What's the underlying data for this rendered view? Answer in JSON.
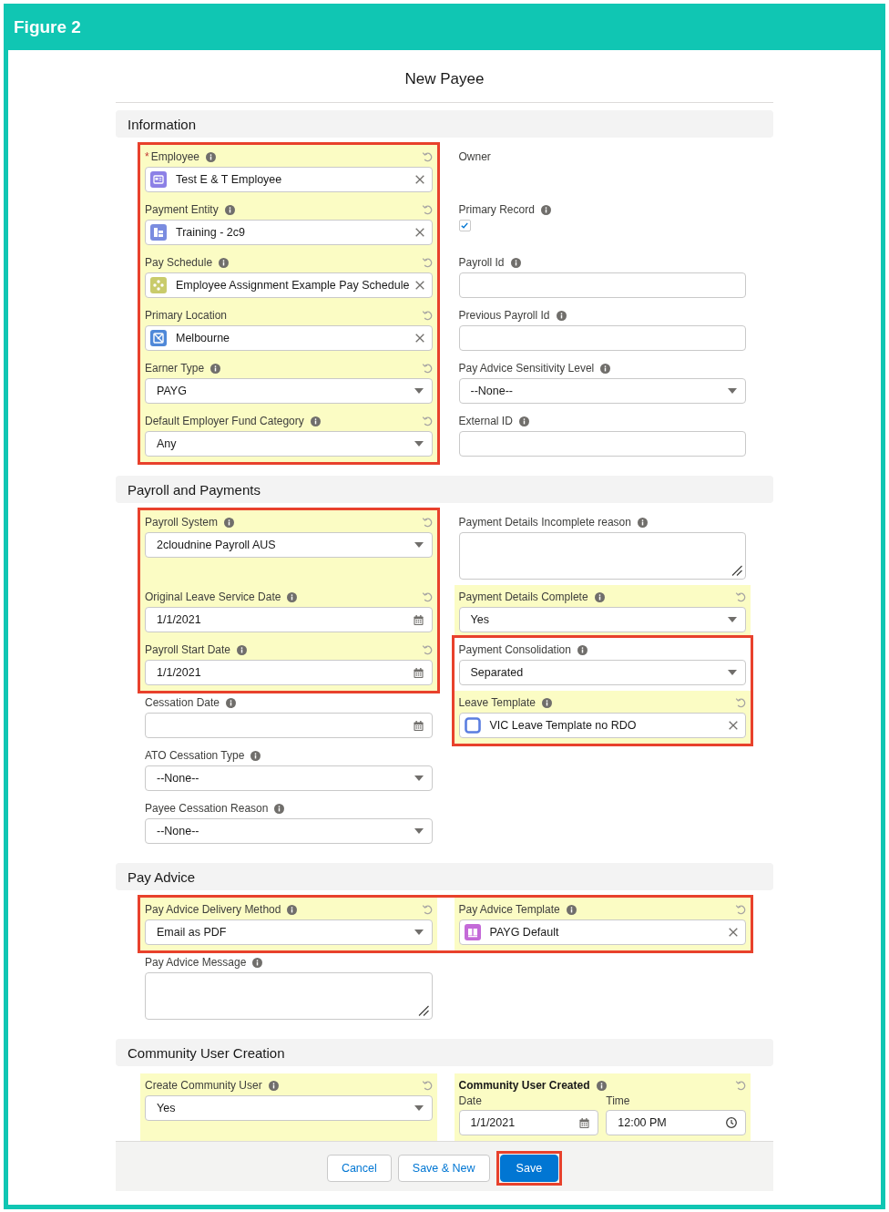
{
  "figure": {
    "title": "Figure 2"
  },
  "modal": {
    "title": "New Payee"
  },
  "sections": [
    {
      "title": "Information",
      "blocks": [
        {
          "kind": "columns",
          "left": [
            {
              "kind": "callout",
              "fields": [
                {
                  "kind": "lookup",
                  "label": "Employee",
                  "required_mark": "*",
                  "info": true,
                  "edited": true,
                  "value": "Test E & T Employee",
                  "color": "#8c80e6"
                },
                {
                  "kind": "lookup",
                  "label": "Payment Entity",
                  "info": true,
                  "edited": true,
                  "value": "Training - 2c9",
                  "color": "#7a8ce0"
                },
                {
                  "kind": "lookup",
                  "label": "Pay Schedule",
                  "info": true,
                  "edited": true,
                  "value": "Employee Assignment Example Pay Schedule",
                  "color": "#c9cb6b"
                },
                {
                  "kind": "lookup",
                  "label": "Primary Location",
                  "info": false,
                  "edited": true,
                  "value": "Melbourne",
                  "color": "#4f88d8"
                },
                {
                  "kind": "picklist",
                  "label": "Earner Type",
                  "info": true,
                  "edited": true,
                  "value": "PAYG"
                },
                {
                  "kind": "picklist",
                  "label": "Default Employer Fund Category",
                  "info": true,
                  "edited": true,
                  "value": "Any"
                }
              ]
            }
          ],
          "right": [
            {
              "kind": "output",
              "label": "Owner",
              "info": false,
              "edited": false
            },
            {
              "kind": "checkbox",
              "label": "Primary Record",
              "info": true,
              "edited": false,
              "checked": true
            },
            {
              "kind": "text",
              "label": "Payroll Id",
              "info": true,
              "edited": false
            },
            {
              "kind": "text",
              "label": "Previous Payroll Id",
              "info": true,
              "edited": false
            },
            {
              "kind": "picklist",
              "label": "Pay Advice Sensitivity Level",
              "info": true,
              "edited": false,
              "value": "--None--"
            },
            {
              "kind": "text",
              "label": "External ID",
              "info": true,
              "edited": false
            }
          ]
        }
      ]
    },
    {
      "title": "Payroll and Payments",
      "blocks": [
        {
          "kind": "columns",
          "left": [
            {
              "kind": "callout",
              "fields": [
                {
                  "kind": "picklist",
                  "label": "Payroll System",
                  "info": true,
                  "edited": true,
                  "value": "2cloudnine Payroll AUS"
                },
                {
                  "kind": "date",
                  "label": "Original Leave Service Date",
                  "info": true,
                  "edited": true,
                  "value": "1/1/2021"
                },
                {
                  "kind": "date",
                  "label": "Payroll Start Date",
                  "info": true,
                  "edited": true,
                  "value": "1/1/2021"
                }
              ]
            },
            {
              "kind": "date",
              "label": "Cessation Date",
              "info": true,
              "edited": false
            },
            {
              "kind": "picklist",
              "label": "ATO Cessation Type",
              "info": true,
              "edited": false,
              "value": "--None--"
            },
            {
              "kind": "picklist",
              "label": "Payee Cessation Reason",
              "info": true,
              "edited": false,
              "value": "--None--"
            }
          ],
          "right": [
            {
              "kind": "textarea",
              "label": "Payment Details Incomplete reason",
              "info": true,
              "edited": false
            },
            {
              "kind": "picklist",
              "label": "Payment Details Complete",
              "info": true,
              "edited": true,
              "value": "Yes"
            },
            {
              "kind": "callout",
              "fields": [
                {
                  "kind": "picklist",
                  "label": "Payment Consolidation",
                  "info": true,
                  "edited": false,
                  "value": "Separated"
                },
                {
                  "kind": "lookup",
                  "label": "Leave Template",
                  "info": true,
                  "edited": true,
                  "value": "VIC Leave Template no RDO",
                  "color": "#5b7ee0"
                }
              ]
            }
          ]
        }
      ]
    },
    {
      "title": "Pay Advice",
      "blocks": [
        {
          "kind": "callout",
          "left": [
            {
              "kind": "picklist",
              "label": "Pay Advice Delivery Method",
              "info": true,
              "edited": true,
              "value": "Email as PDF"
            }
          ],
          "right": [
            {
              "kind": "lookup",
              "label": "Pay Advice Template",
              "info": true,
              "edited": true,
              "value": "PAYG Default",
              "color": "#c46ad8"
            }
          ]
        },
        {
          "kind": "columns",
          "left": [
            {
              "kind": "textarea",
              "label": "Pay Advice Message",
              "info": true,
              "edited": false
            }
          ]
        }
      ]
    },
    {
      "title": "Community User Creation",
      "blocks": [
        {
          "kind": "columns",
          "left": [
            {
              "kind": "picklist",
              "label": "Create Community User",
              "info": true,
              "edited": true,
              "value": "Yes"
            }
          ],
          "right": [
            {
              "kind": "datetime",
              "label": "Community User Created",
              "info": true,
              "edited": true,
              "date_label": "Date",
              "date": "1/1/2021",
              "time_label": "Time",
              "time": "12:00 PM"
            }
          ]
        }
      ]
    }
  ],
  "footer": {
    "buttons": [
      {
        "label": "Cancel",
        "kind": "neutral",
        "outlined": false
      },
      {
        "label": "Save & New",
        "kind": "neutral",
        "outlined": false
      },
      {
        "label": "Save",
        "kind": "brand",
        "outlined": true
      }
    ]
  }
}
